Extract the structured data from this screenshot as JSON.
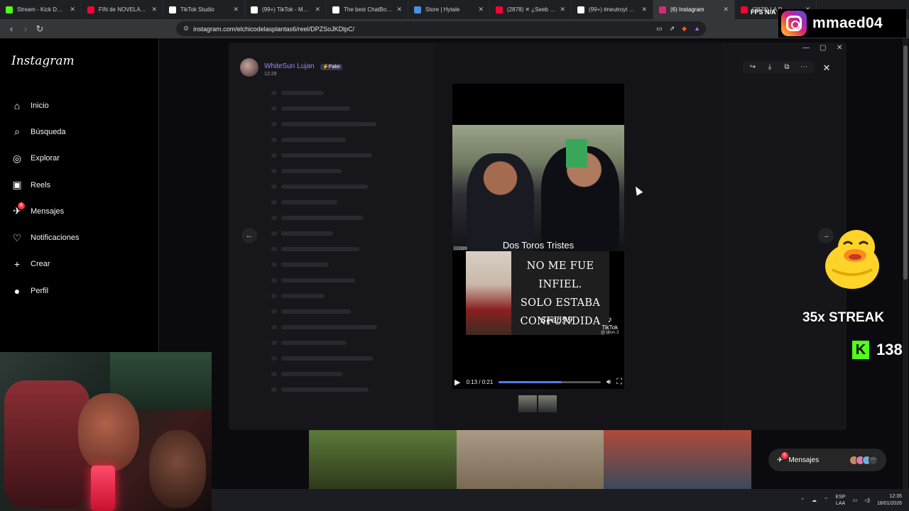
{
  "browser": {
    "tabs": [
      {
        "title": "Stream - Kick Dashboa",
        "color": "#53fc18",
        "active": false
      },
      {
        "title": "FIN de NOVELA CH",
        "color": "#ff0033",
        "active": false
      },
      {
        "title": "TikTok Studio",
        "color": "#ffffff",
        "active": false
      },
      {
        "title": "(99+) TikTok - Make Yo",
        "color": "#ffffff",
        "active": false
      },
      {
        "title": "The best ChatBot and",
        "color": "#ffffff",
        "active": false
      },
      {
        "title": "Store | Hytale",
        "color": "#4a90e2",
        "active": false
      },
      {
        "title": "(2878) ✕ ¿Seeb PE",
        "color": "#ff0033",
        "active": false
      },
      {
        "title": "(99+) #neutroyt #csgo",
        "color": "#ffffff",
        "active": false
      },
      {
        "title": "(6) Instagram",
        "color": "#d62976",
        "active": true
      },
      {
        "title": "(2878) LA R",
        "color": "#ff0033",
        "active": false
      }
    ],
    "url": "instagram.com/elchicodelasplantas6/reel/DPZSoJKDlpC/"
  },
  "instagram": {
    "logo": "Instagram",
    "menu": [
      {
        "label": "Inicio",
        "icon": "home-icon",
        "glyph": "⌂"
      },
      {
        "label": "Búsqueda",
        "icon": "search-icon",
        "glyph": "⌕"
      },
      {
        "label": "Explorar",
        "icon": "compass-icon",
        "glyph": "◎"
      },
      {
        "label": "Reels",
        "icon": "reels-icon",
        "glyph": "▣"
      },
      {
        "label": "Mensajes",
        "icon": "messenger-icon",
        "glyph": "✈",
        "badge": "6"
      },
      {
        "label": "Notificaciones",
        "icon": "heart-icon",
        "glyph": "♡"
      },
      {
        "label": "Crear",
        "icon": "plus-icon",
        "glyph": "+"
      },
      {
        "label": "Perfil",
        "icon": "profile-avatar-icon",
        "glyph": "●"
      }
    ],
    "messages_pill": {
      "label": "Mensajes",
      "badge": "6"
    }
  },
  "post": {
    "username": "WhiteSun Lujan",
    "user_badge": "⚡Pake",
    "time": "12:29",
    "caption_top": "Dos Toros Tristes",
    "watermark_small": "EEB99",
    "meme_lines": [
      "NO ME FUE INFIEL.",
      "SOLO ESTABA",
      "CONFUNDIDA"
    ],
    "meme_signature": "Seeb99",
    "tiktok_label": "TikTok",
    "tiktok_user": "@ dilon.3"
  },
  "player": {
    "time": "0:13 / 0:21",
    "progress": 0.62
  },
  "overlay": {
    "fps_label": "FPS N/A",
    "ig_handle": "mmaed04",
    "streak": "35x STREAK",
    "kick_count": "138"
  },
  "taskbar": {
    "lang_top": "ESP",
    "lang_bottom": "LAA",
    "time": "12:35",
    "date": "18/01/2026"
  }
}
